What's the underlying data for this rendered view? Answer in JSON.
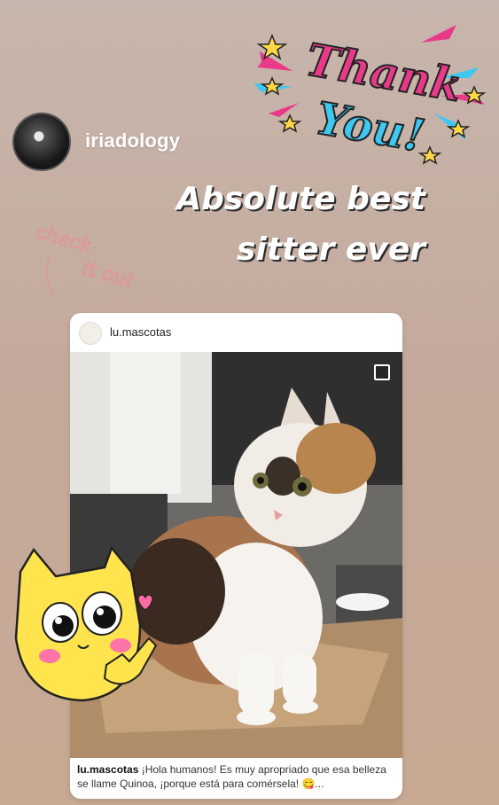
{
  "story": {
    "username": "iriadology",
    "headline_line1": "Absolute best",
    "headline_line2": "sitter ever"
  },
  "stickers": {
    "thank_you_line1": "Thank",
    "thank_you_line2": "You!",
    "check_it_out_line1": "check",
    "check_it_out_line2": "it out",
    "cat_icon": "yellow-cat-sticker"
  },
  "post": {
    "username": "lu.mascotas",
    "caption_user": "lu.mascotas",
    "caption_text": " ¡Hola humanos! Es muy apropriado que esa belleza se llame Quinoa, ¡porque está para comérsela! 😋..."
  },
  "colors": {
    "background": "#c4aa9c",
    "card": "#ffffff",
    "thank_you_pink": "#e93a8a",
    "thank_you_blue": "#3ec7f0",
    "star_yellow": "#ffd84a",
    "cat_yellow": "#ffe44d"
  }
}
